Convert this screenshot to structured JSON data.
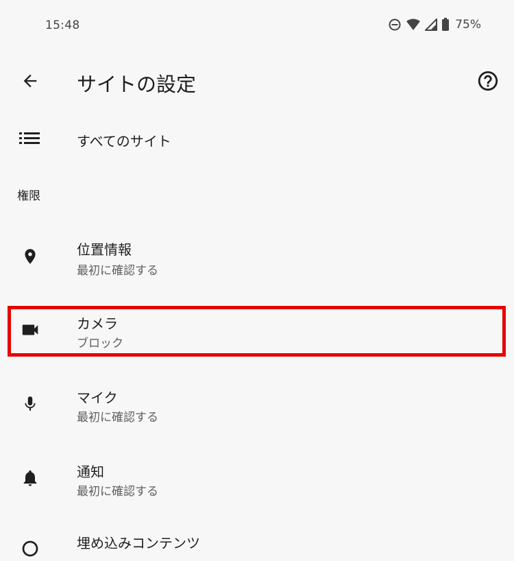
{
  "status_bar": {
    "time": "15:48",
    "battery": "75%",
    "icons": [
      "do-not-disturb-icon",
      "wifi-icon",
      "signal-icon",
      "battery-icon"
    ]
  },
  "app_bar": {
    "back_icon": "arrow-back-icon",
    "title": "サイトの設定",
    "help_icon": "help-circle-icon"
  },
  "all_sites": {
    "icon": "list-icon",
    "label": "すべてのサイト"
  },
  "section": {
    "permissions_label": "権限"
  },
  "permissions": [
    {
      "icon": "location-pin-icon",
      "title": "位置情報",
      "subtitle": "最初に確認する"
    },
    {
      "icon": "videocam-icon",
      "title": "カメラ",
      "subtitle": "ブロック"
    },
    {
      "icon": "mic-icon",
      "title": "マイク",
      "subtitle": "最初に確認する"
    },
    {
      "icon": "bell-icon",
      "title": "通知",
      "subtitle": "最初に確認する"
    },
    {
      "icon": "embed-icon",
      "title": "埋め込みコンテンツ"
    }
  ],
  "colors": {
    "background": "#f7f7f7",
    "highlight": "#e60000",
    "text_primary": "#1f1f1f",
    "text_secondary": "#5f5f5f"
  }
}
